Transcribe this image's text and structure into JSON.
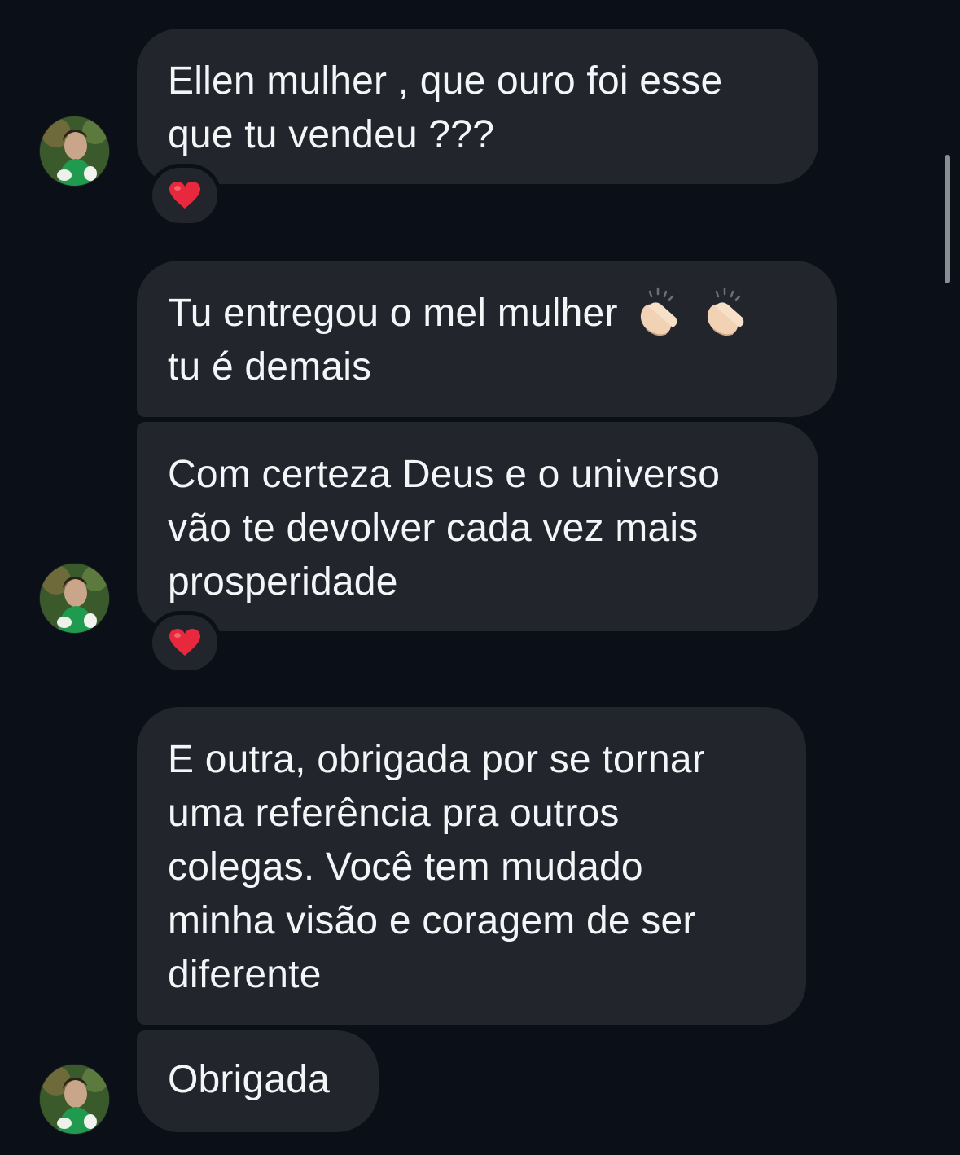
{
  "messages": [
    {
      "lines": [
        "Ellen mulher , que ouro foi esse",
        "que tu vendeu ???"
      ],
      "reaction": "red-heart"
    },
    {
      "lines": [
        "Tu entregou o mel mulher",
        "tu é demais"
      ],
      "inline_icons": [
        "clapping-hands-icon",
        "clapping-hands-icon"
      ]
    },
    {
      "lines": [
        "Com certeza Deus e o universo",
        "vão te devolver cada vez mais",
        "prosperidade"
      ],
      "reaction": "red-heart"
    },
    {
      "lines": [
        "E outra, obrigada por se tornar",
        "uma referência pra outros",
        "colegas. Você tem mudado",
        "minha visão e coragem de ser",
        "diferente"
      ]
    },
    {
      "lines": [
        "Obrigada"
      ]
    }
  ],
  "theme": {
    "background": "#0b0f17",
    "bubble": "#22252c",
    "text": "#f4f5f7",
    "heart": "#e8283c"
  }
}
